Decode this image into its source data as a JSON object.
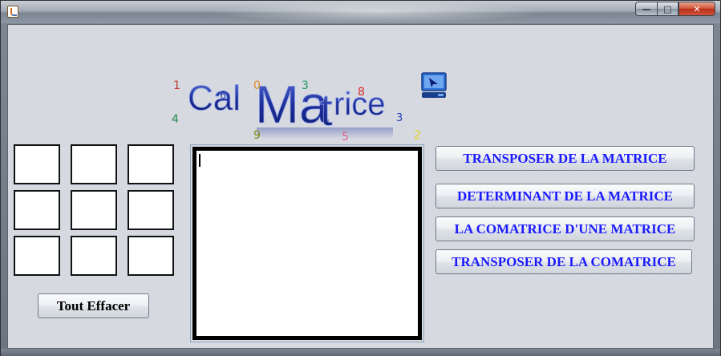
{
  "window": {
    "title": "",
    "controls": {
      "minimize": "—",
      "maximize": "□",
      "close": "✕"
    }
  },
  "logo": {
    "word_left": "Cal",
    "word_right_big": "Ma",
    "word_right_t": "t",
    "word_right_rest": "rice",
    "digits": [
      "1",
      "4",
      "6",
      "0",
      "3",
      "9",
      "5",
      "8",
      "3",
      "2"
    ],
    "colors": {
      "text": "#1c2f9c",
      "digit_1": "#c0392b",
      "digit_4": "#1f8a4c",
      "digit_6": "#2b3fa8",
      "digit_0": "#e08a1e",
      "digit_3a": "#1f9a62",
      "digit_9": "#7a8a12",
      "digit_5": "#e35c8c",
      "digit_8": "#d42b2b",
      "digit_3b": "#2a40b8",
      "digit_2": "#e8d21c"
    },
    "icon": "computer-cursor-icon"
  },
  "matrix": {
    "rows": [
      [
        "",
        "",
        ""
      ],
      [
        "",
        "",
        ""
      ],
      [
        "",
        "",
        ""
      ]
    ]
  },
  "result": {
    "value": ""
  },
  "buttons": {
    "clear_all": "Tout Effacer",
    "transpose": "TRANSPOSER DE LA MATRICE",
    "determinant": "DETERMINANT DE LA MATRICE",
    "comatrix": "LA COMATRICE D'UNE MATRICE",
    "transpose_comatrix": "TRANSPOSER DE LA COMATRICE"
  },
  "colors": {
    "button_text_blue": "#1a1aff",
    "client_bg": "#d6d9e0"
  }
}
